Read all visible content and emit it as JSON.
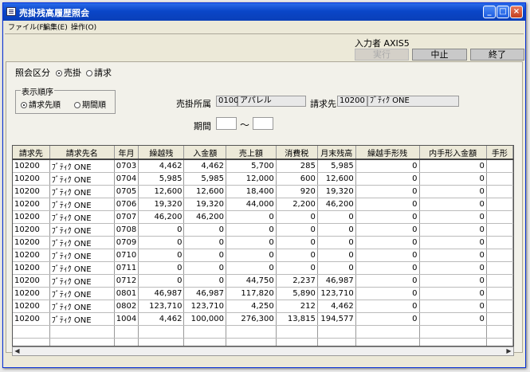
{
  "window": {
    "title": "売掛残高履歴照会"
  },
  "menu": [
    {
      "label": "ファイル(F)"
    },
    {
      "label": "編集(E)"
    },
    {
      "label": "操作(O)"
    }
  ],
  "header": {
    "operator_label": "入力者",
    "operator_name": "AXIS5"
  },
  "buttons": {
    "run": "実行",
    "stop": "中止",
    "exit": "終了"
  },
  "inquiry": {
    "label": "照会区分",
    "options": [
      "売掛",
      "請求"
    ],
    "selected": "売掛"
  },
  "order": {
    "label": "表示順序",
    "options": [
      "請求先順",
      "期間順"
    ],
    "selected": "請求先順"
  },
  "filters": {
    "dept_label": "売掛所属",
    "dept_code": "0100",
    "dept_name": "アパレル",
    "customer_label": "請求先",
    "customer_code": "10200",
    "customer_name": "ﾌﾞﾃｨｸ ONE",
    "period_label": "期間",
    "period_from": "",
    "period_sep": "～",
    "period_to": ""
  },
  "table": {
    "columns": [
      "請求先",
      "請求先名",
      "年月",
      "繰越残",
      "入金額",
      "売上額",
      "消費税",
      "月末残高",
      "繰越手形残",
      "内手形入金額",
      "手形"
    ],
    "rows": [
      [
        "10200",
        "ﾌﾞﾃｨｸ ONE",
        "0703",
        "4,462",
        "4,462",
        "5,700",
        "285",
        "5,985",
        "0",
        "0",
        ""
      ],
      [
        "10200",
        "ﾌﾞﾃｨｸ ONE",
        "0704",
        "5,985",
        "5,985",
        "12,000",
        "600",
        "12,600",
        "0",
        "0",
        ""
      ],
      [
        "10200",
        "ﾌﾞﾃｨｸ ONE",
        "0705",
        "12,600",
        "12,600",
        "18,400",
        "920",
        "19,320",
        "0",
        "0",
        ""
      ],
      [
        "10200",
        "ﾌﾞﾃｨｸ ONE",
        "0706",
        "19,320",
        "19,320",
        "44,000",
        "2,200",
        "46,200",
        "0",
        "0",
        ""
      ],
      [
        "10200",
        "ﾌﾞﾃｨｸ ONE",
        "0707",
        "46,200",
        "46,200",
        "0",
        "0",
        "0",
        "0",
        "0",
        ""
      ],
      [
        "10200",
        "ﾌﾞﾃｨｸ ONE",
        "0708",
        "0",
        "0",
        "0",
        "0",
        "0",
        "0",
        "0",
        ""
      ],
      [
        "10200",
        "ﾌﾞﾃｨｸ ONE",
        "0709",
        "0",
        "0",
        "0",
        "0",
        "0",
        "0",
        "0",
        ""
      ],
      [
        "10200",
        "ﾌﾞﾃｨｸ ONE",
        "0710",
        "0",
        "0",
        "0",
        "0",
        "0",
        "0",
        "0",
        ""
      ],
      [
        "10200",
        "ﾌﾞﾃｨｸ ONE",
        "0711",
        "0",
        "0",
        "0",
        "0",
        "0",
        "0",
        "0",
        ""
      ],
      [
        "10200",
        "ﾌﾞﾃｨｸ ONE",
        "0712",
        "0",
        "0",
        "44,750",
        "2,237",
        "46,987",
        "0",
        "0",
        ""
      ],
      [
        "10200",
        "ﾌﾞﾃｨｸ ONE",
        "0801",
        "46,987",
        "46,987",
        "117,820",
        "5,890",
        "123,710",
        "0",
        "0",
        ""
      ],
      [
        "10200",
        "ﾌﾞﾃｨｸ ONE",
        "0802",
        "123,710",
        "123,710",
        "4,250",
        "212",
        "4,462",
        "0",
        "0",
        ""
      ],
      [
        "10200",
        "ﾌﾞﾃｨｸ ONE",
        "1004",
        "4,462",
        "100,000",
        "276,300",
        "13,815",
        "194,577",
        "0",
        "0",
        ""
      ]
    ],
    "empty_rows": 2
  },
  "colors": {
    "titlebar": "#0a46c8",
    "window_bg": "#ece9d8"
  }
}
